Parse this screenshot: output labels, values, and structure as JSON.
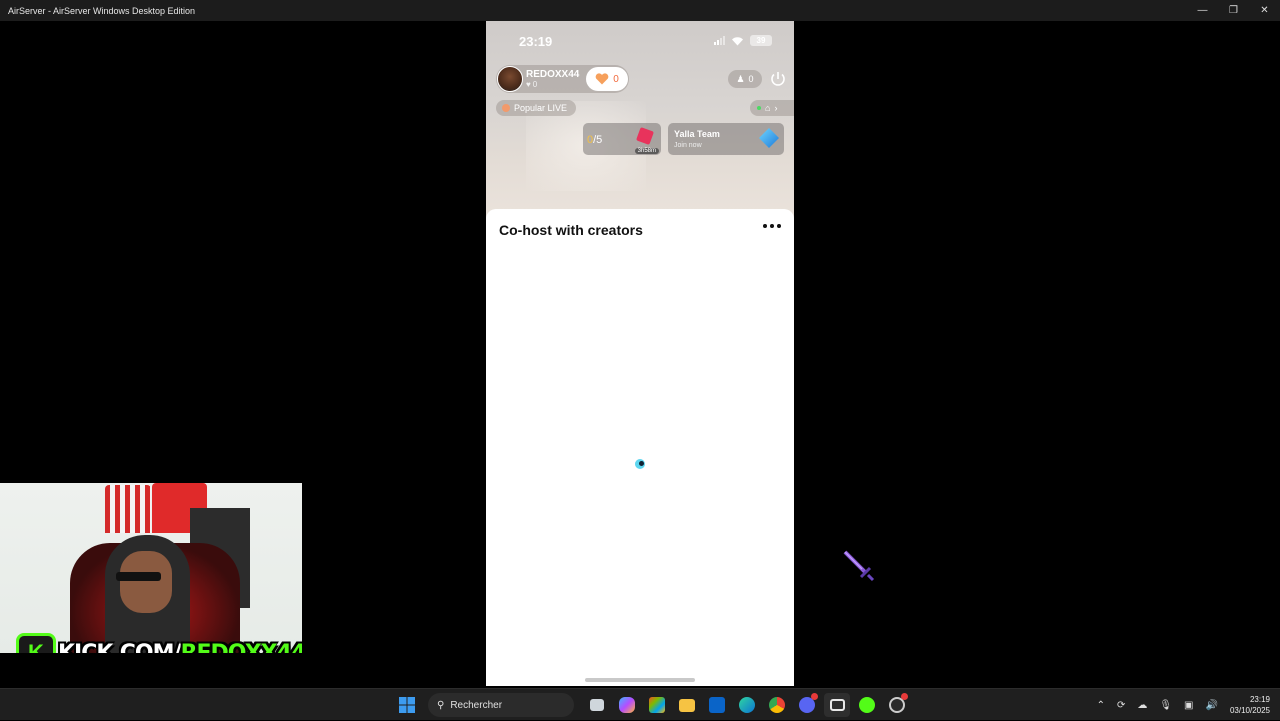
{
  "window": {
    "title": "AirServer - AirServer Windows Desktop Edition",
    "controls": [
      "minimize-icon",
      "maximize-icon",
      "close-icon"
    ]
  },
  "phone": {
    "status": {
      "time": "23:19",
      "battery": "39"
    },
    "host": {
      "name": "REDOXX44",
      "sub_count": "0",
      "likes": "0"
    },
    "viewers": "0",
    "popular_label": "Popular LIVE",
    "task": {
      "progress_current": "0",
      "progress_total": "/5",
      "timer": "3h58m"
    },
    "team": {
      "name": "Yalla Team",
      "action": "Join now"
    },
    "sheet": {
      "title": "Co-host with creators"
    }
  },
  "overlay": {
    "kick_prefix": "KICK.COM/",
    "kick_name": "REDOXX44"
  },
  "taskbar": {
    "search_placeholder": "Rechercher",
    "clock_time": "23:19",
    "clock_date": "03/10/2025",
    "colors": {
      "windows": "#3d9cf0",
      "accent_green": "#53fc18"
    }
  }
}
